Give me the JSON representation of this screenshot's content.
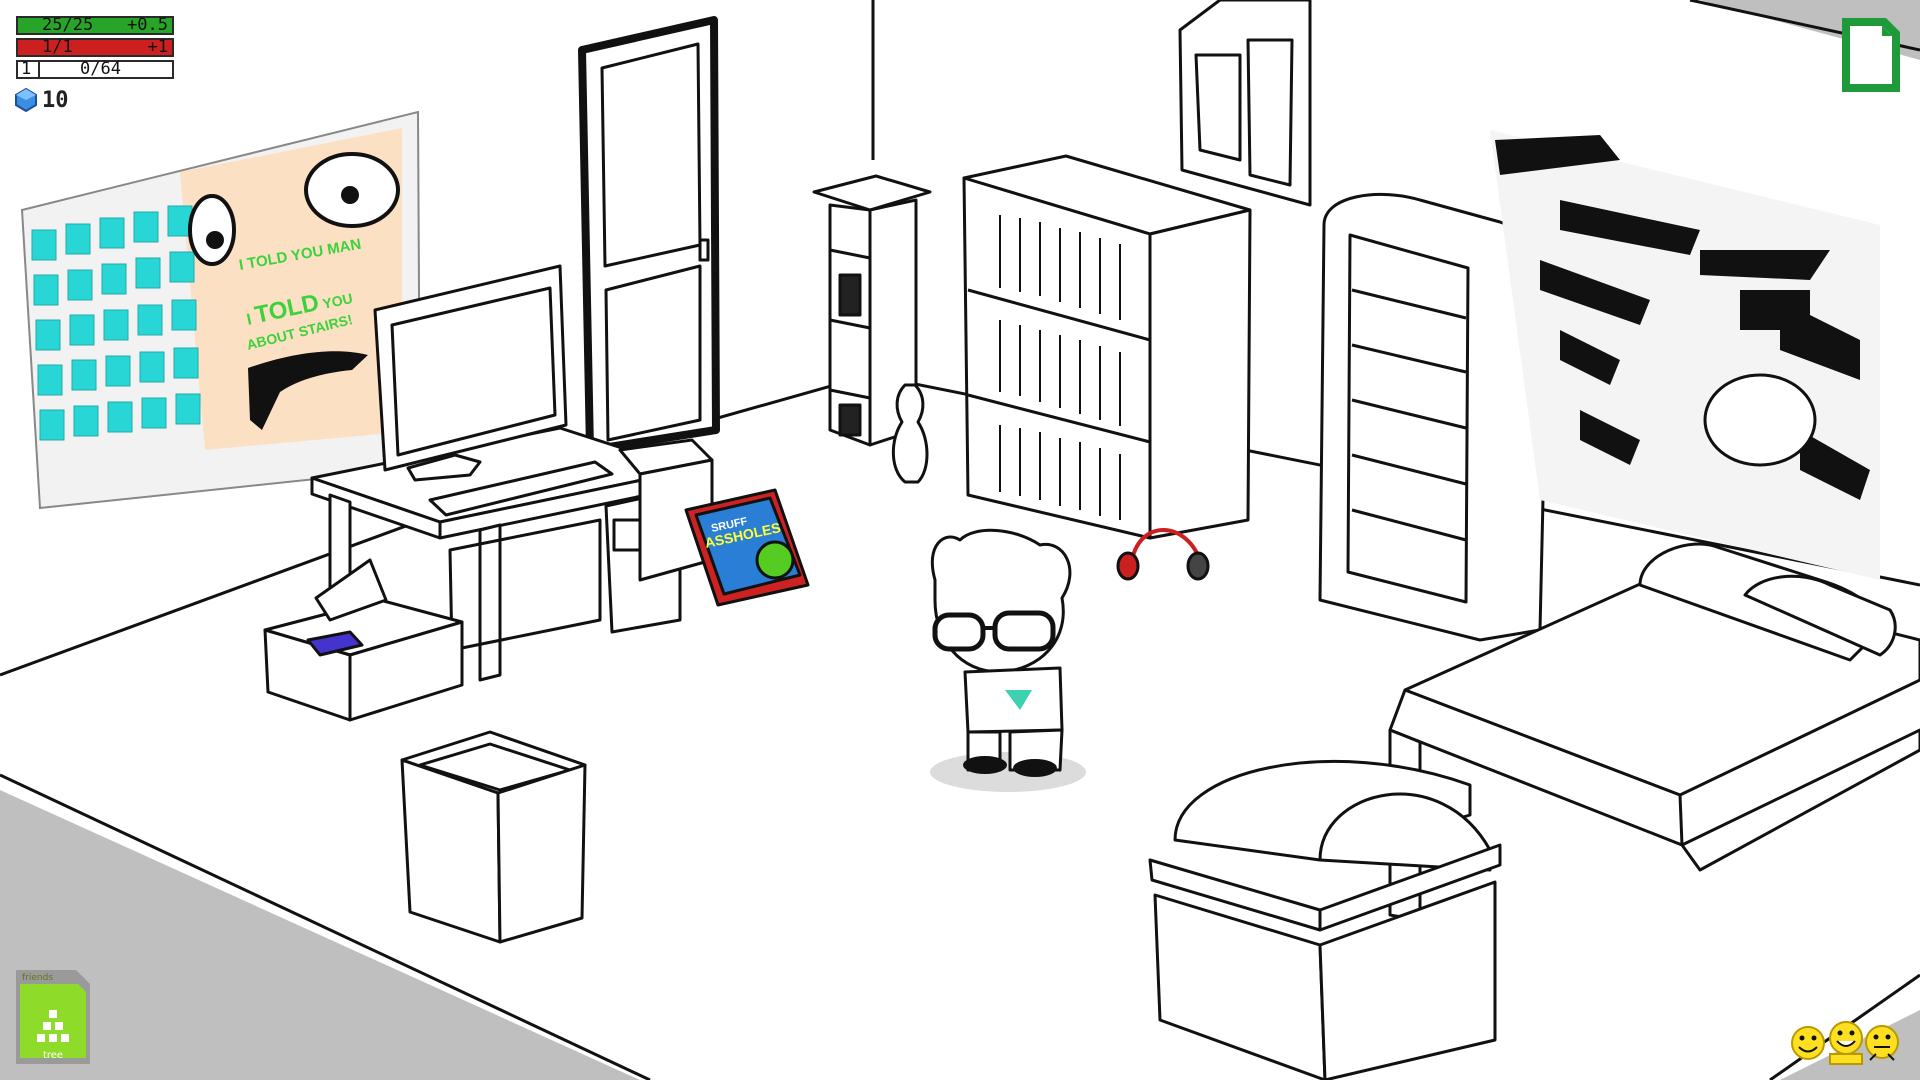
{
  "hud": {
    "health": {
      "current": "25/25",
      "rate": "+0.5",
      "fill": 1.0,
      "color": "#28a428"
    },
    "aspect": {
      "current": "1/1",
      "rate": "+1",
      "fill": 1.0,
      "color": "#cc1f1f"
    },
    "experience": {
      "level": "1",
      "current": "0/64",
      "fill": 0.0
    },
    "grist": {
      "icon": "build-grist-icon",
      "count": "10"
    }
  },
  "poster": {
    "line1": "I TOLD YOU MAN",
    "line2_a": "I ",
    "line2_b": "TOLD",
    "line2_c": " YOU",
    "line3": "ABOUT STAIRS!"
  },
  "book": {
    "top_text": "SRUFF",
    "title": "ASSHOLES"
  },
  "controls": {
    "menu_icon": "file-menu-icon",
    "tree_button": {
      "top_label": "friends",
      "bottom_label": "tree",
      "icon": "family-tree-icon"
    },
    "chum_icons": [
      "smiley-icon",
      "smiley-icon",
      "smiley-icon"
    ]
  },
  "colors": {
    "health": "#28a428",
    "aspect": "#cc1f1f",
    "tree_green": "#8fdb2a",
    "poster_text": "#3bd23b"
  }
}
